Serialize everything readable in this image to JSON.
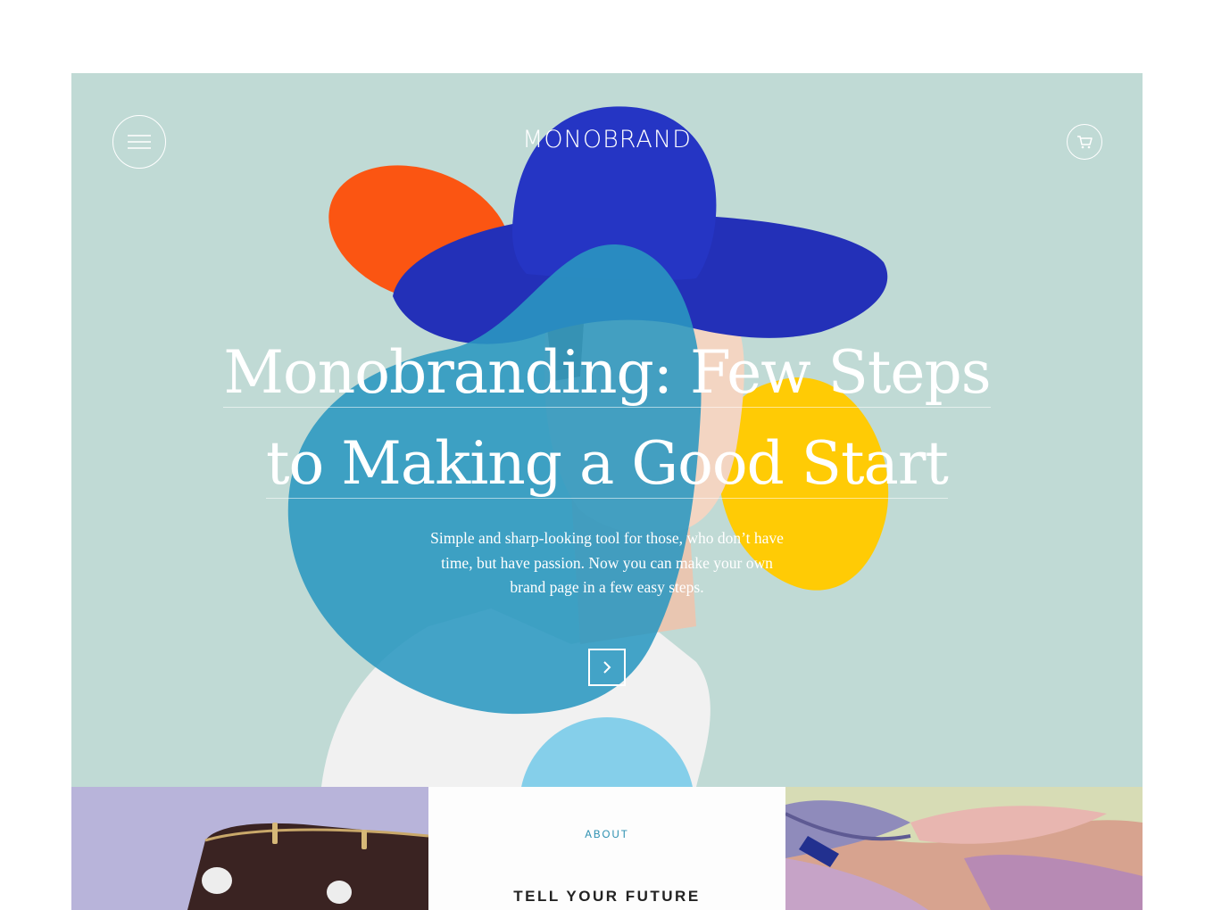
{
  "brand": {
    "logo": "MONOBRAND"
  },
  "hero": {
    "headline_line1": "Monobranding: Few Steps",
    "headline_line2": "to Making a Good Start",
    "subtitle": "Simple and sharp-looking tool for those, who don’t have time, but have passion. Now you can make your own brand page in a few easy steps.",
    "background_color": "#c0dad5"
  },
  "icons": {
    "menu": "hamburger-menu-icon",
    "cart": "shopping-cart-icon",
    "next": "chevron-right-icon"
  },
  "sections": {
    "about_label": "ABOUT",
    "about_heading": "TELL YOUR FUTURE"
  },
  "colors": {
    "orange": "#fb5512",
    "blue_blob": "#2a97c0",
    "yellow": "#ffcb05",
    "hat": "#2330b8",
    "light_blue": "#85cfea",
    "lavender": "#b8b4da",
    "sage": "#d7dcb5",
    "accent": "#2a8fb0"
  }
}
